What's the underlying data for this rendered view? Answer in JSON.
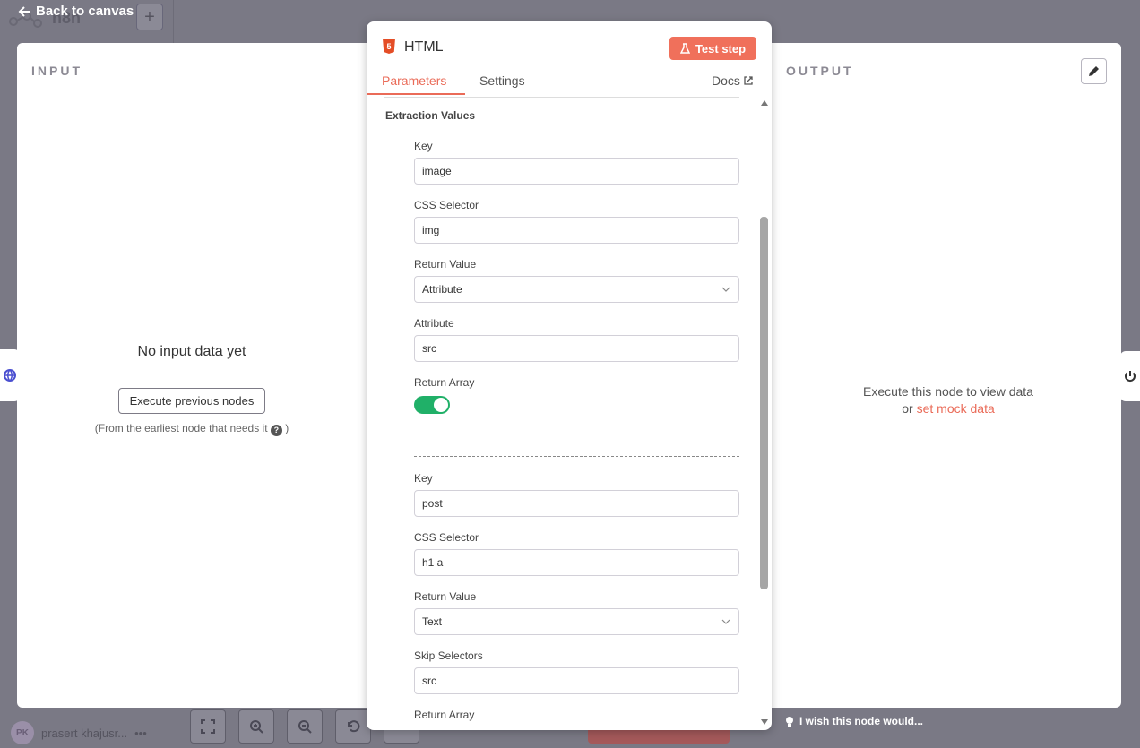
{
  "canvas": {
    "back_label": "Back to canvas",
    "workflow_title": "n8n",
    "add_symbol": "+",
    "user_initials": "PK",
    "user_name": "prasert khajusr...",
    "more_symbol": "•••",
    "wish_text": "I wish this node would..."
  },
  "input_panel": {
    "title": "INPUT",
    "empty_message": "No input data yet",
    "execute_button": "Execute previous nodes",
    "hint": "(From the earliest node that needs it",
    "hint_end": ")"
  },
  "output_panel": {
    "title": "OUTPUT",
    "message_line1": "Execute this node to view data",
    "message_or": "or",
    "mock_link": "set mock data"
  },
  "node": {
    "title": "HTML",
    "badge": "5",
    "test_button": "Test step",
    "tabs": {
      "parameters": "Parameters",
      "settings": "Settings",
      "docs": "Docs"
    },
    "section_title": "Extraction Values",
    "groups": [
      {
        "key_label": "Key",
        "key_value": "image",
        "selector_label": "CSS Selector",
        "selector_value": "img",
        "return_label": "Return Value",
        "return_value": "Attribute",
        "extra_label": "Attribute",
        "extra_value": "src",
        "array_label": "Return Array",
        "array_on": true
      },
      {
        "key_label": "Key",
        "key_value": "post",
        "selector_label": "CSS Selector",
        "selector_value": "h1 a",
        "return_label": "Return Value",
        "return_value": "Text",
        "extra_label": "Skip Selectors",
        "extra_value": "src",
        "array_label": "Return Array"
      }
    ]
  },
  "colors": {
    "accent": "#ea6b58",
    "test_button": "#f0705b",
    "toggle_on": "#20b068",
    "overlay": "#7a7985"
  }
}
